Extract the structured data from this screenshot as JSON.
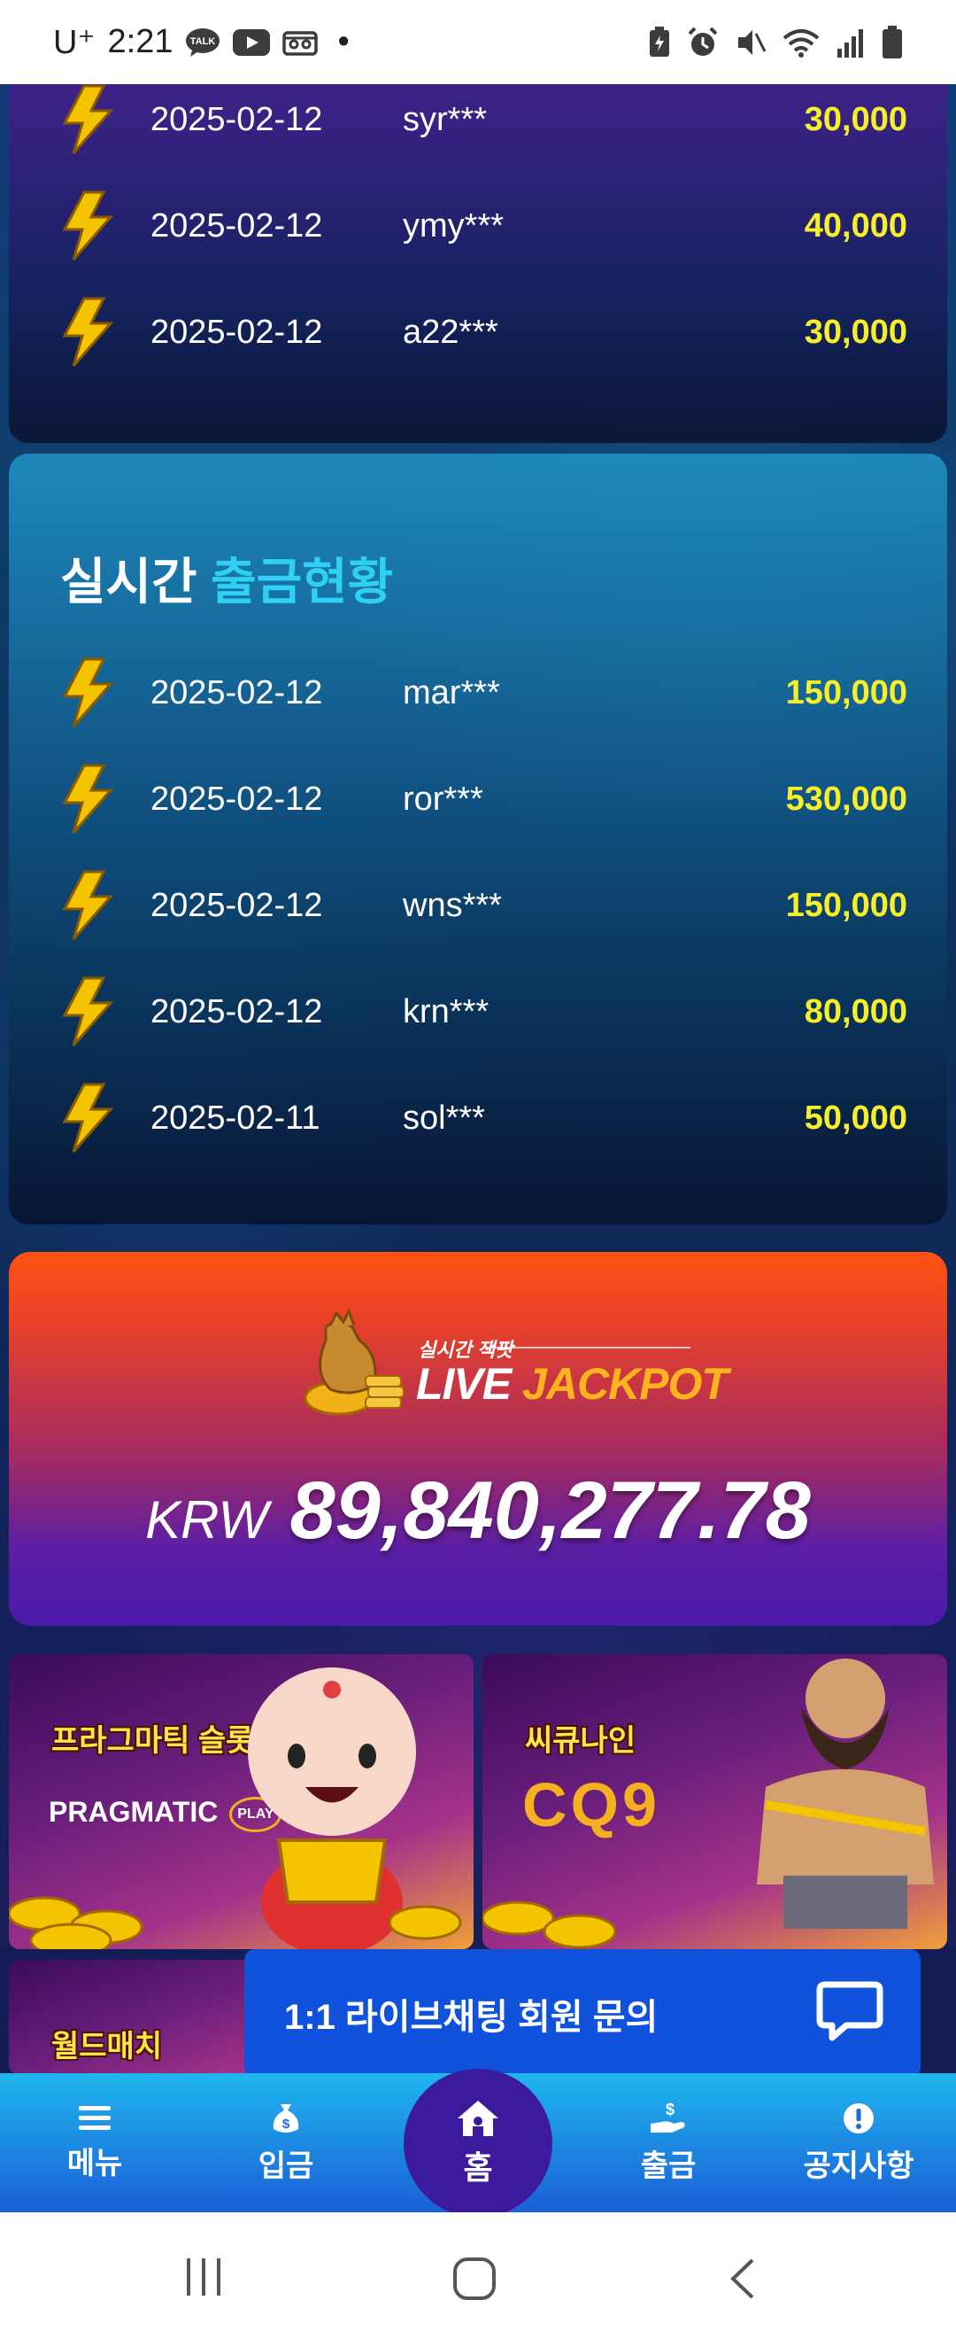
{
  "status_bar": {
    "carrier": "U⁺",
    "time": "2:21",
    "dot": "•"
  },
  "top_list": {
    "rows": [
      {
        "date": "2025-02-12",
        "user": "syr***",
        "amount": "30,000"
      },
      {
        "date": "2025-02-12",
        "user": "ymy***",
        "amount": "40,000"
      },
      {
        "date": "2025-02-12",
        "user": "a22***",
        "amount": "30,000"
      }
    ]
  },
  "withdraw_panel": {
    "title_prefix": "실시간",
    "title_accent": "출금현황",
    "rows": [
      {
        "date": "2025-02-12",
        "user": "mar***",
        "amount": "150,000"
      },
      {
        "date": "2025-02-12",
        "user": "ror***",
        "amount": "530,000"
      },
      {
        "date": "2025-02-12",
        "user": "wns***",
        "amount": "150,000"
      },
      {
        "date": "2025-02-12",
        "user": "krn***",
        "amount": "80,000"
      },
      {
        "date": "2025-02-11",
        "user": "sol***",
        "amount": "50,000"
      }
    ]
  },
  "jackpot": {
    "small_label": "실시간 잭팟",
    "live": "LIVE",
    "jackpot": "JACKPOT",
    "currency": "KRW",
    "value": "89,840,277.78"
  },
  "games": [
    {
      "label": "프라그마틱 슬롯",
      "brand": "PRAGMATIC",
      "brand_badge": "PLAY"
    },
    {
      "label": "씨큐나인",
      "brand": "CQ9"
    },
    {
      "label": "월드매치"
    }
  ],
  "chat_button": {
    "label": "1:1 라이브채팅 회원 문의"
  },
  "bottom_nav": {
    "menu": "메뉴",
    "deposit": "입금",
    "home": "홈",
    "withdraw": "출금",
    "notice": "공지사항"
  },
  "colors": {
    "amount": "#f7ef2a",
    "accent": "#2fd0f3",
    "chat_bg": "#1152dc",
    "home_circle": "#3c1a9e"
  }
}
